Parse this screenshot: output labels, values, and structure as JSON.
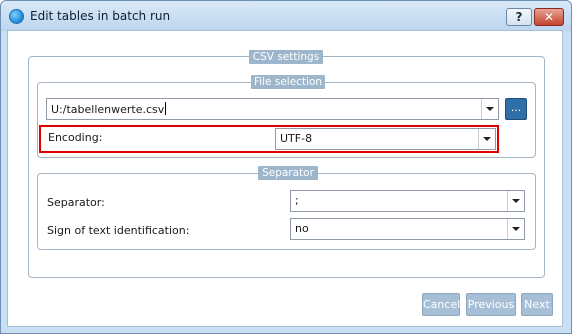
{
  "window": {
    "title": "Edit tables in batch run",
    "help_label": "?",
    "close_label": "✕"
  },
  "csv_settings": {
    "legend": "CSV settings"
  },
  "file_selection": {
    "legend": "File selection",
    "file_value": "U:/tabellenwerte.csv",
    "browse_label": "...",
    "encoding_label": "Encoding:",
    "encoding_value": "UTF-8"
  },
  "separator_group": {
    "legend": "Separator",
    "separator_label": "Separator:",
    "separator_value": ";",
    "text_id_label": "Sign of text identification:",
    "text_id_value": "no"
  },
  "buttons": {
    "cancel": "Cancel",
    "previous": "Previous",
    "next": "Next"
  }
}
